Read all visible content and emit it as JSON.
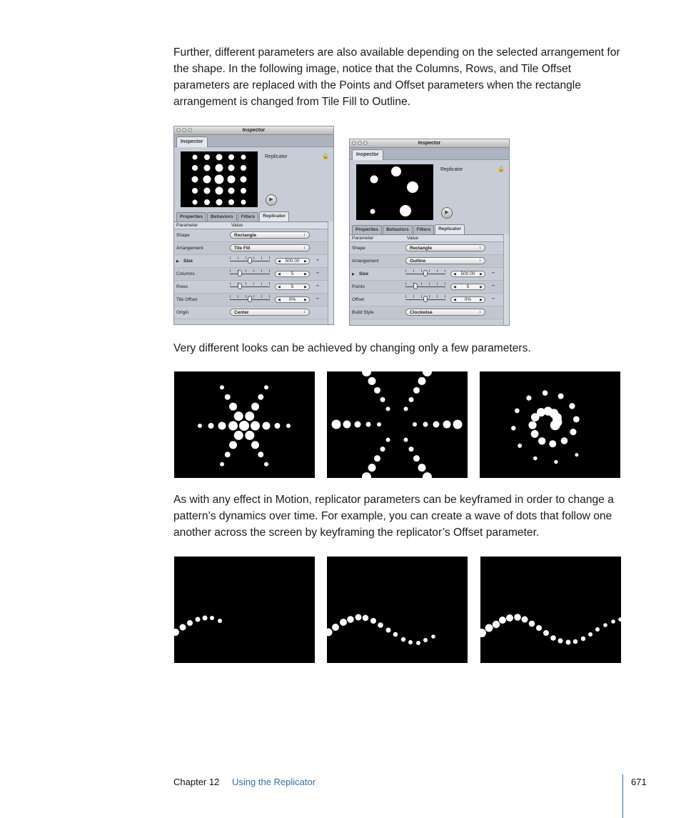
{
  "paragraphs": {
    "intro": "Further, different parameters are also available depending on the selected arrangement for the shape. In the following image, notice that the Columns, Rows, and Tile Offset parameters are replaced with the Points and Offset parameters when the rectangle arrangement is changed from Tile Fill to Outline.",
    "looks": "Very different looks can be achieved by changing only a few parameters.",
    "keyframe": "As with any effect in Motion, replicator parameters can be keyframed in order to change a pattern’s dynamics over time. For example, you can create a wave of dots that follow one another across the screen by keyframing the replicator’s Offset parameter."
  },
  "inspectors": [
    {
      "window_title": "Inspector",
      "top_tab": "Inspector",
      "object_name": "Replicator",
      "preview": "tile-fill-grid",
      "tabs": [
        "Properties",
        "Behaviors",
        "Filters",
        "Replicator"
      ],
      "active_tab": "Replicator",
      "columns": [
        "Parameter",
        "Value"
      ],
      "rows": [
        {
          "label": "Shape",
          "type": "popup",
          "value": "Rectangle"
        },
        {
          "label": "Arrangement",
          "type": "popup",
          "value": "Tile Fill"
        },
        {
          "label": "Size",
          "type": "slider",
          "value": "500.00",
          "slider_fraction": 0.5,
          "disclosure": true
        },
        {
          "label": "Columns",
          "type": "slider",
          "value": "5",
          "slider_fraction": 0.25
        },
        {
          "label": "Rows",
          "type": "slider",
          "value": "5",
          "slider_fraction": 0.25
        },
        {
          "label": "Tile Offset",
          "type": "slider",
          "value": "0%",
          "slider_fraction": 0.5
        },
        {
          "label": "Origin",
          "type": "popup",
          "value": "Center"
        }
      ]
    },
    {
      "window_title": "Inspector",
      "top_tab": "Inspector",
      "object_name": "Replicator",
      "preview": "outline-dots",
      "tabs": [
        "Properties",
        "Behaviors",
        "Filters",
        "Replicator"
      ],
      "active_tab": "Replicator",
      "columns": [
        "Parameter",
        "Value"
      ],
      "rows": [
        {
          "label": "Shape",
          "type": "popup",
          "value": "Rectangle"
        },
        {
          "label": "Arrangement",
          "type": "popup",
          "value": "Outline"
        },
        {
          "label": "Size",
          "type": "slider",
          "value": "500.00",
          "slider_fraction": 0.5,
          "disclosure": true
        },
        {
          "label": "Points",
          "type": "slider",
          "value": "5",
          "slider_fraction": 0.25
        },
        {
          "label": "Offset",
          "type": "slider",
          "value": "0%",
          "slider_fraction": 0.5
        },
        {
          "label": "Build Style",
          "type": "popup",
          "value": "Clockwise"
        }
      ]
    }
  ],
  "examples_row1": [
    "star-burst-large-center",
    "star-burst-large-outer",
    "spiral"
  ],
  "examples_row2": [
    "wave-partial",
    "wave-half",
    "wave-full"
  ],
  "icons": {
    "lock": "lock-icon",
    "play": "play-icon",
    "popup_arrows": "updown-arrows-icon"
  },
  "footer": {
    "chapter": "Chapter 12",
    "title": "Using the Replicator",
    "page": "671",
    "accent_color": "#3a6fa0"
  }
}
